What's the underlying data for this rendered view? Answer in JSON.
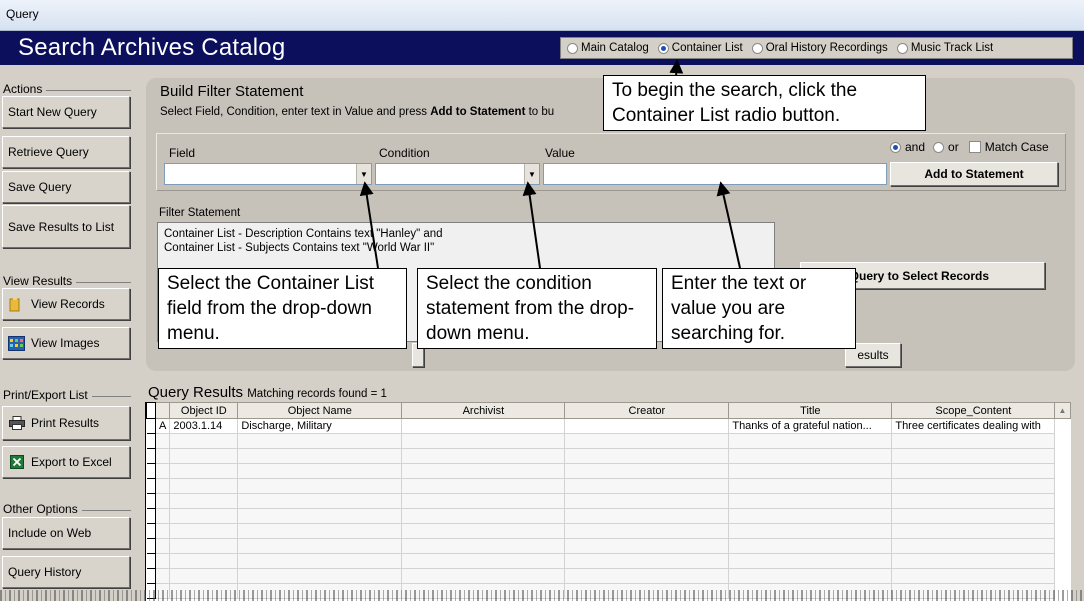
{
  "window": {
    "title": "Query"
  },
  "header": {
    "app_title": "Search Archives Catalog",
    "catalog_options": [
      {
        "label": "Main Catalog",
        "selected": false
      },
      {
        "label": "Container List",
        "selected": true
      },
      {
        "label": "Oral History Recordings",
        "selected": false
      },
      {
        "label": "Music Track List",
        "selected": false
      }
    ]
  },
  "sidebar": {
    "actions_label": "Actions",
    "start_new_query": "Start New Query",
    "retrieve_query": "Retrieve Query",
    "save_query": "Save Query",
    "save_results_to_list": "Save Results to List",
    "view_results_label": "View Results",
    "view_records": "View Records",
    "view_images": "View Images",
    "print_export_label": "Print/Export List",
    "print_results": "Print Results",
    "export_to_excel": "Export to Excel",
    "other_options_label": "Other Options",
    "include_on_web": "Include on Web",
    "query_history": "Query History"
  },
  "filter": {
    "title": "Build Filter Statement",
    "hint_prefix": "Select Field, Condition, enter text in Value and press ",
    "hint_bold": "Add to Statement",
    "hint_suffix": " to bu",
    "field_label": "Field",
    "condition_label": "Condition",
    "value_label": "Value",
    "field_value": "",
    "condition_value": "",
    "value_value": "",
    "and_label": "and",
    "or_label": "or",
    "match_case_label": "Match Case",
    "and_selected": true,
    "add_to_statement": "Add to Statement",
    "filter_statement_label": "Filter Statement",
    "statement_lines": [
      "Container List - Description Contains text \"Hanley\" and",
      "Container List - Subjects Contains text \"World War II\""
    ],
    "run_query_button": "n Query to Select Records",
    "results_button": "esults"
  },
  "callouts": {
    "top": "To begin the search, click the Container List radio button.",
    "field": "Select the Container List field from the drop-down menu.",
    "condition": "Select the condition statement from the drop-down menu.",
    "value": "Enter the text or value you are searching for."
  },
  "results": {
    "title": "Query Results",
    "count_text": "Matching records found = 1",
    "columns": [
      "Object ID",
      "Object Name",
      "Archivist",
      "Creator",
      "Title",
      "Scope_Content"
    ],
    "rows": [
      {
        "marker": "A",
        "cells": [
          "2003.1.14",
          "Discharge, Military",
          "",
          "",
          "Thanks of a grateful nation...",
          "Three certificates dealing with"
        ]
      }
    ]
  }
}
